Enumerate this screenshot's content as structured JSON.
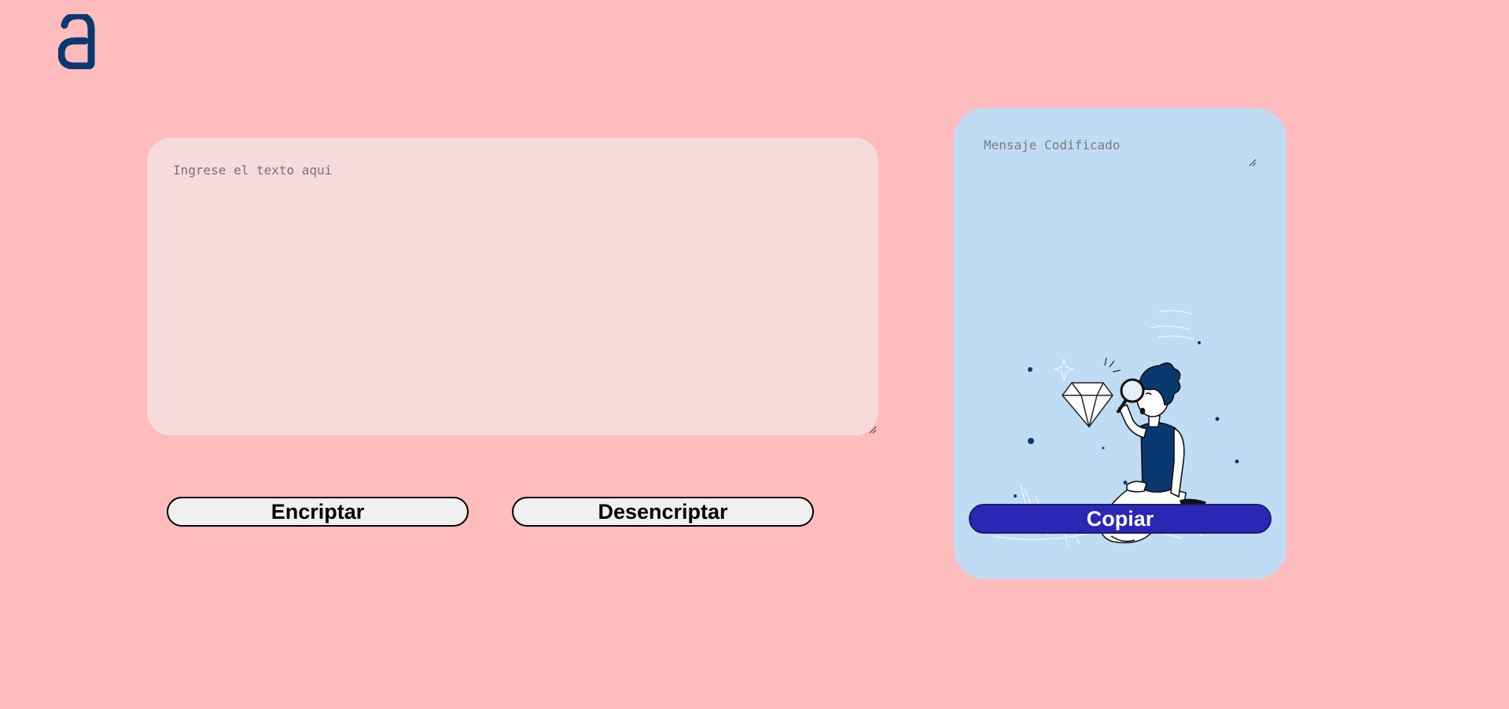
{
  "logo": {
    "icon": "alura-a-logo-icon",
    "color": "#0a3871"
  },
  "input": {
    "placeholder": "Ingrese el texto aqui",
    "value": ""
  },
  "buttons": {
    "encrypt_label": "Encriptar",
    "decrypt_label": "Desencriptar"
  },
  "output": {
    "placeholder": "Mensaje Codificado",
    "illustration": "person-with-magnifier-and-diamond-illustration",
    "copy_label": "Copiar"
  },
  "colors": {
    "background": "#ffbcbc",
    "input_bg": "#f7dadc",
    "card_bg": "#c0dcf4",
    "copy_button_bg": "#2a27b4",
    "primary_button_bg": "#f0f0f0",
    "logo": "#0a3871"
  }
}
